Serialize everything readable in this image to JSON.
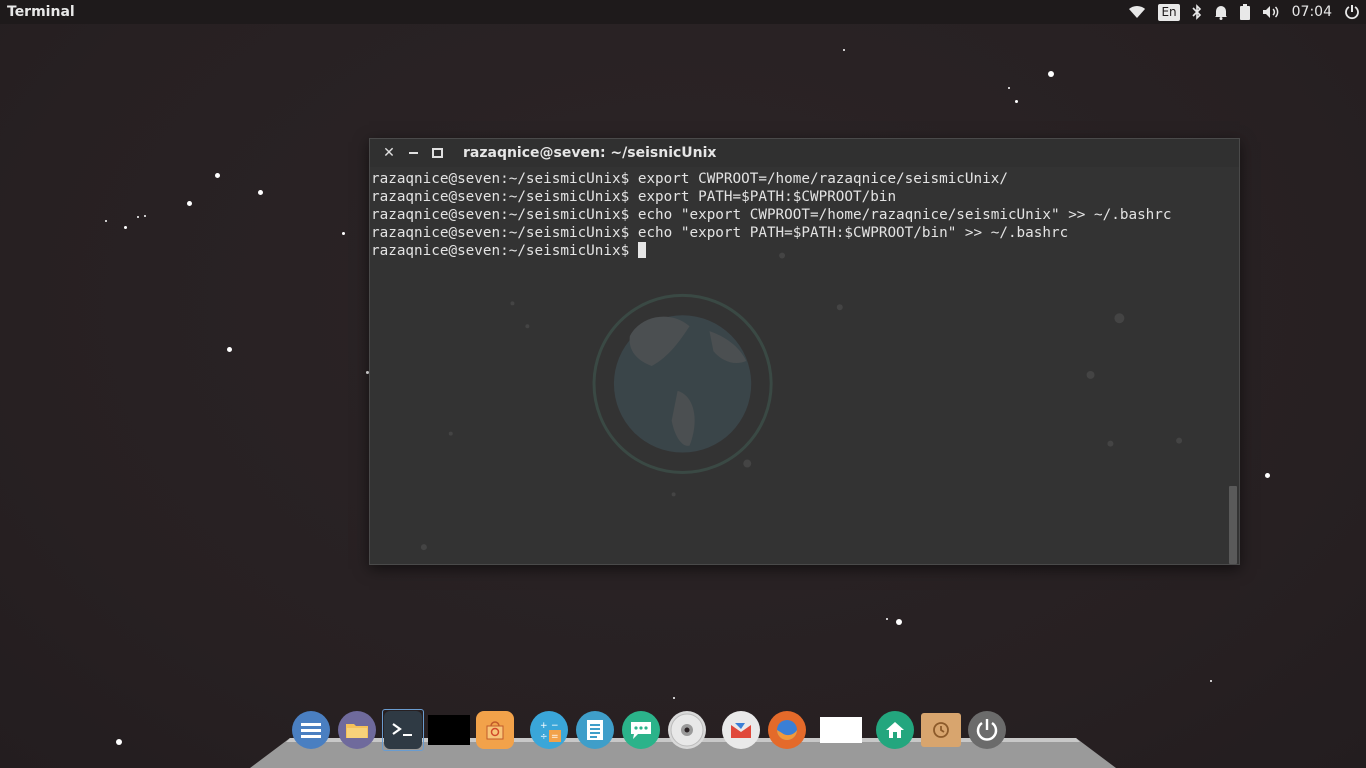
{
  "top_panel": {
    "app_title": "Terminal",
    "keyboard_layout": "En",
    "clock": "07:04",
    "icons": [
      "wifi-icon",
      "keyboard-layout-indicator",
      "bluetooth-icon",
      "notification-bell-icon",
      "battery-icon",
      "volume-icon",
      "session-power-icon"
    ]
  },
  "terminal": {
    "title": "razaqnice@seven: ~/seisnicUnix",
    "lines": [
      "razaqnice@seven:~/seismicUnix$ export CWPROOT=/home/razaqnice/seismicUnix/",
      "razaqnice@seven:~/seismicUnix$ export PATH=$PATH:$CWPROOT/bin",
      "razaqnice@seven:~/seismicUnix$ echo \"export CWPROOT=/home/razaqnice/seismicUnix\" >> ~/.bashrc",
      "razaqnice@seven:~/seismicUnix$ echo \"export PATH=$PATH:$CWPROOT/bin\" >> ~/.bashrc"
    ],
    "prompt": "razaqnice@seven:~/seismicUnix$ "
  },
  "dock": {
    "items": [
      {
        "name": "app-menu",
        "icon": "menu-icon",
        "color": "#4a7fc1"
      },
      {
        "name": "files",
        "icon": "folder-icon",
        "color": "#6f6a9c"
      },
      {
        "name": "terminal",
        "icon": "terminal-icon",
        "color": "#2f3a44"
      },
      {
        "name": "blank-window",
        "icon": "window-icon",
        "color": "#000000"
      },
      {
        "name": "software-center",
        "icon": "shopping-bag-icon",
        "color": "#f2a24a"
      },
      {
        "name": "calculator",
        "icon": "calculator-icon",
        "color": "#3aa6d9"
      },
      {
        "name": "text-editor",
        "icon": "document-icon",
        "color": "#3f9ec9"
      },
      {
        "name": "messaging",
        "icon": "chat-icon",
        "color": "#2bb38a"
      },
      {
        "name": "disc-burner",
        "icon": "cd-icon",
        "color": "#d9d9d9"
      },
      {
        "name": "mail",
        "icon": "mail-icon",
        "color": "#e9e9e9"
      },
      {
        "name": "firefox",
        "icon": "firefox-icon",
        "color": "#e46a2a"
      },
      {
        "name": "blank-window-2",
        "icon": "window-icon",
        "color": "#ffffff"
      },
      {
        "name": "home",
        "icon": "home-icon",
        "color": "#23a67e"
      },
      {
        "name": "backups",
        "icon": "backup-folder-icon",
        "color": "#d8a56e"
      },
      {
        "name": "shutdown",
        "icon": "power-icon",
        "color": "#6b6b6b"
      }
    ]
  }
}
